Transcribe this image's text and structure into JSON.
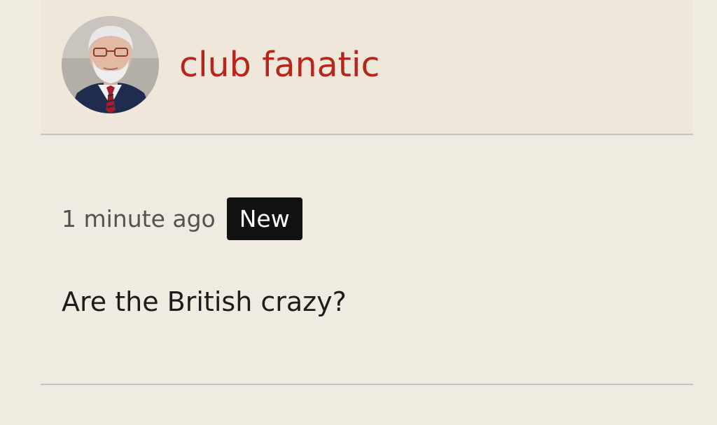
{
  "post": {
    "author": {
      "name": "club fanatic",
      "avatar_icon": "user-avatar-photo"
    },
    "timestamp": "1 minute ago",
    "badge": "New",
    "body": "Are the British crazy?"
  },
  "colors": {
    "background": "#f0ebe1",
    "header_background": "#efe7da",
    "author_name": "#b5261d",
    "badge_background": "#111111",
    "badge_text": "#ffffff",
    "divider": "#c8c4bd"
  }
}
